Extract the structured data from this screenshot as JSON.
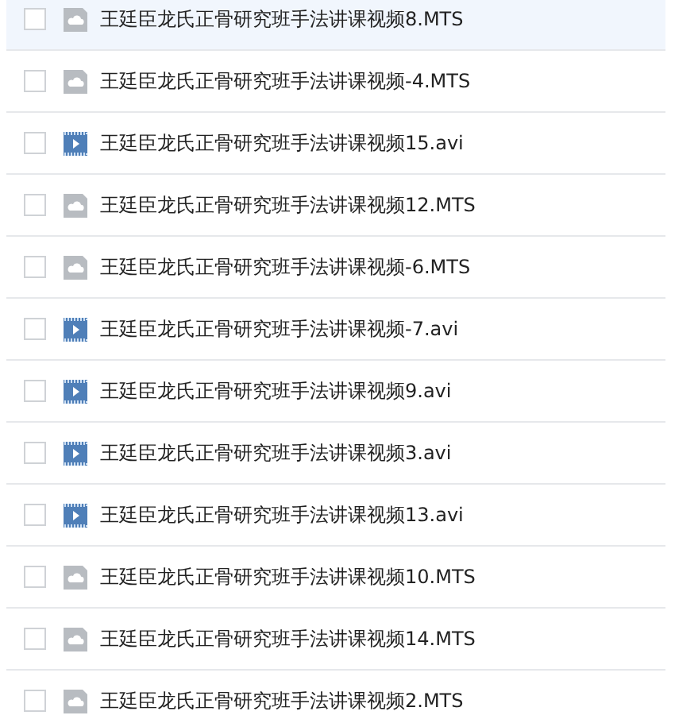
{
  "files": [
    {
      "name": "王廷臣龙氏正骨研究班手法讲课视频8.MTS",
      "kind": "cloud",
      "checked": false,
      "highlighted": true
    },
    {
      "name": "王廷臣龙氏正骨研究班手法讲课视频-4.MTS",
      "kind": "cloud",
      "checked": false,
      "highlighted": false
    },
    {
      "name": "王廷臣龙氏正骨研究班手法讲课视频15.avi",
      "kind": "video",
      "checked": false,
      "highlighted": false
    },
    {
      "name": "王廷臣龙氏正骨研究班手法讲课视频12.MTS",
      "kind": "cloud",
      "checked": false,
      "highlighted": false
    },
    {
      "name": "王廷臣龙氏正骨研究班手法讲课视频-6.MTS",
      "kind": "cloud",
      "checked": false,
      "highlighted": false
    },
    {
      "name": "王廷臣龙氏正骨研究班手法讲课视频-7.avi",
      "kind": "video",
      "checked": false,
      "highlighted": false
    },
    {
      "name": "王廷臣龙氏正骨研究班手法讲课视频9.avi",
      "kind": "video",
      "checked": false,
      "highlighted": false
    },
    {
      "name": "王廷臣龙氏正骨研究班手法讲课视频3.avi",
      "kind": "video",
      "checked": false,
      "highlighted": false
    },
    {
      "name": "王廷臣龙氏正骨研究班手法讲课视频13.avi",
      "kind": "video",
      "checked": false,
      "highlighted": false
    },
    {
      "name": "王廷臣龙氏正骨研究班手法讲课视频10.MTS",
      "kind": "cloud",
      "checked": false,
      "highlighted": false
    },
    {
      "name": "王廷臣龙氏正骨研究班手法讲课视频14.MTS",
      "kind": "cloud",
      "checked": false,
      "highlighted": false
    },
    {
      "name": "王廷臣龙氏正骨研究班手法讲课视频2.MTS",
      "kind": "cloud",
      "checked": false,
      "highlighted": false
    }
  ]
}
